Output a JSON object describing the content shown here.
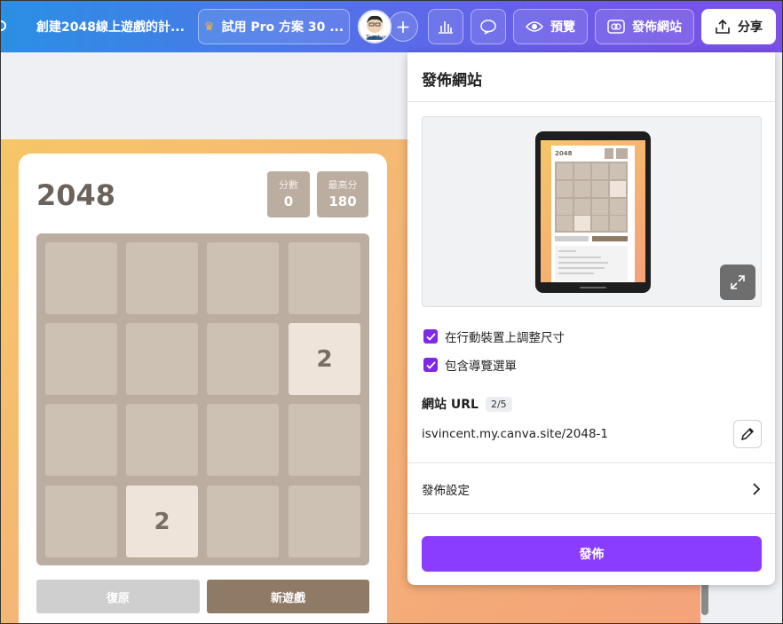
{
  "topbar": {
    "doc_title": "創建2048線上遊戲的計...",
    "pro_label": "試用 Pro 方案 30 ...",
    "avatar_text": "Teacher",
    "preview_label": "預覽",
    "publish_site_label": "發佈網站",
    "share_label": "分享",
    "accent": "#7b4fe6"
  },
  "game": {
    "title": "2048",
    "score_label": "分數",
    "score_value": "0",
    "best_label": "最高分",
    "best_value": "180",
    "tiles": [
      "",
      "",
      "",
      "",
      "",
      "",
      "",
      "2",
      "",
      "",
      "",
      "",
      "",
      "2",
      "",
      ""
    ],
    "undo_label": "復原",
    "new_game_label": "新遊戲"
  },
  "panel": {
    "title": "發佈網站",
    "mini_title": "2048",
    "option_resize_mobile": "在行動裝置上調整尺寸",
    "option_include_nav": "包含導覽選單",
    "url_label": "網站 URL",
    "url_badge": "2/5",
    "url_value": "isvincent.my.canva.site/2048-1",
    "settings_label": "發佈設定",
    "publish_button": "發佈",
    "publish_color": "#8b3dff"
  }
}
